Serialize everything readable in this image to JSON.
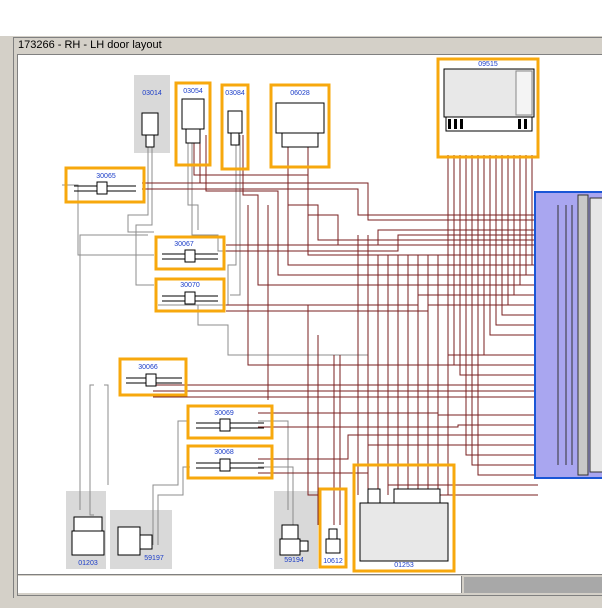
{
  "window": {
    "title": "173266 - RH - LH door layout"
  },
  "colors": {
    "highlight": "#f7a80d",
    "component_bg": "#d9d9d9",
    "wire_dark": "#7a1f1f",
    "wire_grey": "#8c8c8c",
    "label": "#1a3cc8",
    "connector_panel": "#a9a6f0",
    "connector_border": "#1a56d6"
  },
  "components": {
    "c03014": "03014",
    "c03054": "03054",
    "c03084": "03084",
    "c06028": "06028",
    "c09515": "09515",
    "c30065": "30065",
    "c30067": "30067",
    "c30070": "30070",
    "c30066": "30066",
    "c30069": "30069",
    "c30068": "30068",
    "c01203": "01203",
    "c59197": "59197",
    "c59194": "59194",
    "c10612": "10612",
    "c01253": "01253"
  }
}
